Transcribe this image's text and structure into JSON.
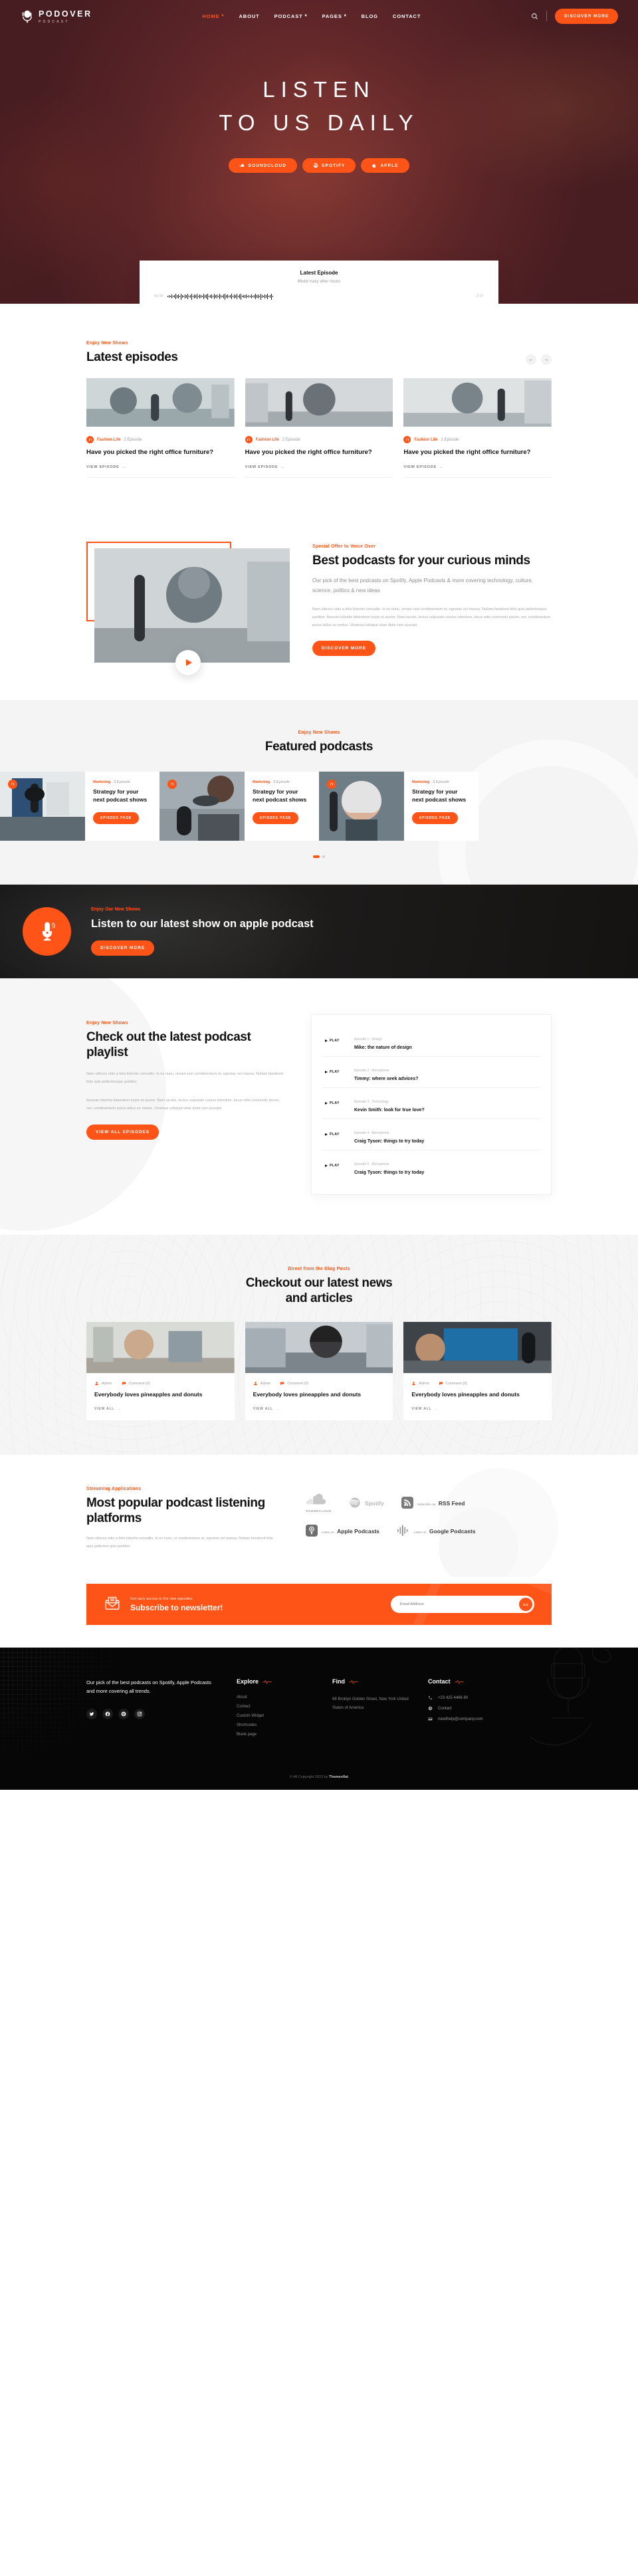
{
  "header": {
    "logo_name": "PODOVER",
    "logo_sub": "PODCAST",
    "nav": [
      {
        "label": "HOME",
        "has_caret": true,
        "active": true
      },
      {
        "label": "ABOUT",
        "has_caret": false,
        "active": false
      },
      {
        "label": "PODCAST",
        "has_caret": true,
        "active": false
      },
      {
        "label": "PAGES",
        "has_caret": true,
        "active": false
      },
      {
        "label": "BLOG",
        "has_caret": false,
        "active": false
      },
      {
        "label": "CONTACT",
        "has_caret": false,
        "active": false
      }
    ],
    "cta_label": "DISCOVER MORE",
    "search_icon": "search-icon"
  },
  "hero": {
    "line1": "LISTEN",
    "line2": "TO US DAILY",
    "buttons": [
      {
        "label": "SOUNDCLOUD",
        "icon": "soundcloud-icon"
      },
      {
        "label": "SPOTIFY",
        "icon": "spotify-icon"
      },
      {
        "label": "APPLE",
        "icon": "apple-icon"
      }
    ]
  },
  "player": {
    "title": "Latest Episode",
    "subtitle": "Mixkit hazy after hours",
    "time_current": "00:00",
    "time_remaining": "-2:07",
    "prev_icon": "skip-back-icon",
    "play_icon": "play-icon",
    "next_icon": "skip-forward-icon"
  },
  "latest": {
    "eyebrow": "Enjoy New Shows",
    "title": "Latest episodes",
    "prev_arrow": "←",
    "next_arrow": "→",
    "link_label": "VIEW EPISODE",
    "episodes": [
      {
        "category": "Fashion Life",
        "count": "2 Episode",
        "title": "Have you picked the right office furniture?"
      },
      {
        "category": "Fashion Life",
        "count": "2 Episode",
        "title": "Have you picked the right office furniture?"
      },
      {
        "category": "Fashion Life",
        "count": "2 Episode",
        "title": "Have you picked the right office furniture?"
      }
    ]
  },
  "best": {
    "eyebrow": "Special Offer to Voice Over",
    "title": "Best podcasts for your curious minds",
    "lead": "Our pick of the best podcasts on Spotify, Apple Podcasts & more covering technology, culture, science, politics & new ideas",
    "body": "Nam ultrices odio a felis lobortis convallis. In ex nunc, ornare non condimentum et, egestas vel massa. Nullam hendrerit felis quis pellentesque porttitor. Aenean lobortis bibendum turpis et auctor. Nam iaculis, lectus vulputate cursus interdum, lacus odio commodo ipsum, nec condimentum purus tellus eu metus. Vivamus volutpat vitae dolor non suscipit.",
    "cta_label": "DISCOVER MORE"
  },
  "featured": {
    "eyebrow": "Enjoy New Shows",
    "title": "Featured podcasts",
    "button_label": "EPISODE PAGE",
    "cards": [
      {
        "category": "Marketing",
        "count": "3 Episode",
        "title": "Strategy for your next podcast shows"
      },
      {
        "category": "Marketing",
        "count": "3 Episode",
        "title": "Strategy for your next podcast shows"
      },
      {
        "category": "Marketing",
        "count": "3 Episode",
        "title": "Strategy for your next podcast shows"
      }
    ]
  },
  "apple_cta": {
    "eyebrow": "Enjoy Our New Shows",
    "title": "Listen to our latest show on apple podcast",
    "cta_label": "DISCOVER MORE",
    "icon": "microphone-icon"
  },
  "playlist": {
    "eyebrow": "Enjoy New Shows",
    "title": "Check out the latest podcast playlist",
    "paragraph1": "Nam ultrices odio a felis lobortis convallis. In ex nunc, ornare non condimentum et, egestas vel massa. Nullam hendrerit felis quis pellentesque porttitor.",
    "paragraph2": "Aenean lobortis bibendum turpis et auctor. Nam iaculis, lectus vulputate cursus interdum, lacus odio commodo ipsum, nec condimentum purus tellus eu metus. Vivamus volutpat vitae dolor non suscipit.",
    "cta_label": "VIEW ALL EPISODES",
    "play_label": "PLAY",
    "items": [
      {
        "meta": "Episode 1 . Design",
        "name": "Mike: the nature of design"
      },
      {
        "meta": "Episode 2 . Microphone",
        "name": "Timmy: where seek advices?"
      },
      {
        "meta": "Episode 3 . Technology",
        "name": "Kevin Smith: look for true love?"
      },
      {
        "meta": "Episode 4 . Microphone",
        "name": "Craig Tyson: things to try today"
      },
      {
        "meta": "Episode 5 . Microphone",
        "name": "Craig Tyson: things to try today"
      }
    ]
  },
  "blog": {
    "eyebrow": "Direct from the Blog Posts",
    "title_line1": "Checkout our latest news",
    "title_line2": "and articles",
    "link_label": "VIEW ALL",
    "posts": [
      {
        "author": "Admin",
        "comments": "Comment (0)",
        "title": "Everybody loves pineapples and donuts"
      },
      {
        "author": "Admin",
        "comments": "Comment (0)",
        "title": "Everybody loves pineapples and donuts"
      },
      {
        "author": "Admin",
        "comments": "Comment (0)",
        "title": "Everybody loves pineapples and donuts"
      }
    ]
  },
  "platforms": {
    "eyebrow": "Streaming Applications",
    "title": "Most popular podcast listening platforms",
    "paragraph": "Nam ultrices odio a felis lobortis convallis. In ex nunc, or condimentum et, egestas vel massa. Nullam hendrerit felis quis pellentes quis porttitor.",
    "items": [
      {
        "icon": "soundcloud-logo",
        "small": "",
        "big": "",
        "caption": "SOUNDCLOUD"
      },
      {
        "icon": "spotify-logo",
        "small": "",
        "big": "Spotify",
        "caption": ""
      },
      {
        "icon": "rss-logo",
        "small": "Subscribe via",
        "big": "RSS Feed",
        "caption": ""
      },
      {
        "icon": "apple-podcasts-logo",
        "small": "Listen on",
        "big": "Apple Podcasts",
        "caption": ""
      },
      {
        "icon": "google-podcasts-logo",
        "small": "Listen on",
        "big": "Google Podcasts",
        "caption": ""
      }
    ]
  },
  "newsletter": {
    "small": "Get early access to the new episodes.",
    "big": "Subscribe to newsletter!",
    "placeholder": "Email Address",
    "button_label": "GO",
    "icon": "envelope-icon"
  },
  "footer": {
    "about": "Our pick of the best podcasts on Spotify, Apple Podcasts and more covering all trends.",
    "social": [
      {
        "name": "twitter-icon"
      },
      {
        "name": "facebook-icon"
      },
      {
        "name": "pinterest-icon"
      },
      {
        "name": "instagram-icon"
      }
    ],
    "explore": {
      "heading": "Explore",
      "links": [
        "About",
        "Contact",
        "Custom Widget",
        "Shortcodes",
        "Blank page"
      ]
    },
    "find": {
      "heading": "Find",
      "address": "88 Broklyn Golden Street, New York United States of America"
    },
    "contact": {
      "heading": "Contact",
      "phone": "+23 425 4466 80",
      "link": "Contact",
      "email": "needhelp@company.com"
    },
    "copyright_prefix": "© All Copyright 2023 by ",
    "copyright_brand": "Themesflat"
  },
  "colors": {
    "accent": "#ff5417",
    "dark": "#060606",
    "hero_overlay": "#5d2a31"
  }
}
